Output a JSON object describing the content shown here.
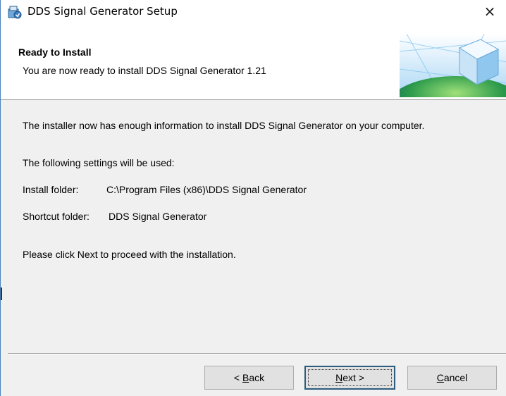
{
  "window": {
    "title": "DDS Signal Generator Setup",
    "close_glyph": "×"
  },
  "header": {
    "title": "Ready to Install",
    "subtitle": "You are now ready to install DDS Signal Generator 1.21"
  },
  "content": {
    "intro": "The installer now has enough information to install DDS Signal Generator on your computer.",
    "settings_heading": "The following settings will be used:",
    "install_folder_label": "Install folder:",
    "install_folder_value": "C:\\Program Files (x86)\\DDS Signal Generator",
    "shortcut_folder_label": "Shortcut folder:",
    "shortcut_folder_value": "DDS Signal Generator",
    "proceed_text": "Please click Next to proceed with the installation."
  },
  "buttons": {
    "back": {
      "prefix": "< ",
      "accel": "B",
      "rest": "ack"
    },
    "next": {
      "accel": "N",
      "rest": "ext >"
    },
    "cancel": {
      "accel": "C",
      "rest": "ancel"
    }
  },
  "colors": {
    "window_border": "#4a7fb8",
    "dialog_bg": "#f0f0f0",
    "default_button_border": "#2c5d7e"
  },
  "icons": {
    "app": "installer-package-icon",
    "header": "installer-cube-graphic"
  }
}
